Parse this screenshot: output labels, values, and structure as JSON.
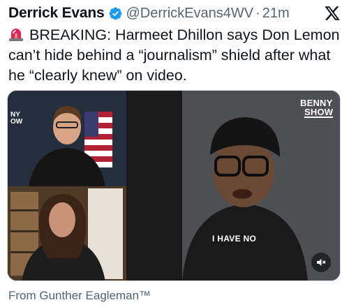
{
  "tweet": {
    "author_name": "Derrick Evans",
    "handle": "@DerrickEvans4WV",
    "separator": "·",
    "time": "21m",
    "text": "BREAKING: Harmeet Dhillon says Don Lemon can’t hide behind a “journalism” shield after what he “clearly knew” on video."
  },
  "media": {
    "caption": "I HAVE NO",
    "show_badge": {
      "line1": "BENNY",
      "line2": "SHOW"
    },
    "left_logo": {
      "line1": "NY",
      "line2": "OW"
    }
  },
  "attribution": "From Gunther Eagleman™",
  "icons": {
    "verified": "verified-badge-icon",
    "platform": "x-logo-icon",
    "alert": "siren-icon",
    "mute": "speaker-muted-icon"
  },
  "colors": {
    "verified": "#1d9bf0",
    "secondary_text": "#536471",
    "siren": "#e0245e"
  }
}
